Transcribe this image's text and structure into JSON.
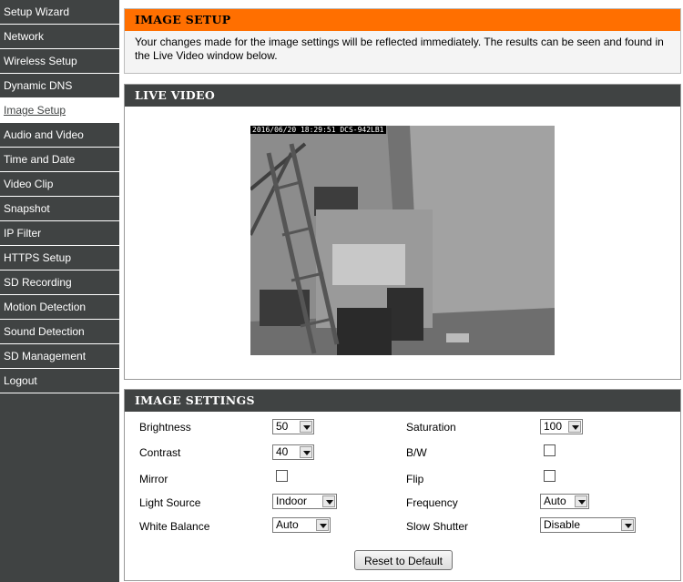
{
  "sidebar": {
    "items": [
      {
        "label": "Setup Wizard"
      },
      {
        "label": "Network"
      },
      {
        "label": "Wireless Setup"
      },
      {
        "label": "Dynamic DNS"
      },
      {
        "label": "Image Setup",
        "active": true
      },
      {
        "label": "Audio and Video"
      },
      {
        "label": "Time and Date"
      },
      {
        "label": "Video Clip"
      },
      {
        "label": "Snapshot"
      },
      {
        "label": "IP Filter"
      },
      {
        "label": "HTTPS Setup"
      },
      {
        "label": "SD Recording"
      },
      {
        "label": "Motion Detection"
      },
      {
        "label": "Sound Detection"
      },
      {
        "label": "SD Management"
      },
      {
        "label": "Logout"
      }
    ]
  },
  "image_setup": {
    "title": "IMAGE SETUP",
    "description": "Your changes made for the image settings will be reflected immediately. The results can be seen and found in the Live Video window below."
  },
  "live_video": {
    "title": "LIVE VIDEO",
    "timestamp": "2016/06/20 18:29:51 DCS-942LB1"
  },
  "image_settings": {
    "title": "IMAGE SETTINGS",
    "brightness": {
      "label": "Brightness",
      "value": "50"
    },
    "saturation": {
      "label": "Saturation",
      "value": "100"
    },
    "contrast": {
      "label": "Contrast",
      "value": "40"
    },
    "bw": {
      "label": "B/W"
    },
    "mirror": {
      "label": "Mirror"
    },
    "flip": {
      "label": "Flip"
    },
    "light_source": {
      "label": "Light Source",
      "value": "Indoor"
    },
    "frequency": {
      "label": "Frequency",
      "value": "Auto"
    },
    "white_balance": {
      "label": "White Balance",
      "value": "Auto"
    },
    "slow_shutter": {
      "label": "Slow Shutter",
      "value": "Disable"
    },
    "reset_label": "Reset to Default"
  }
}
